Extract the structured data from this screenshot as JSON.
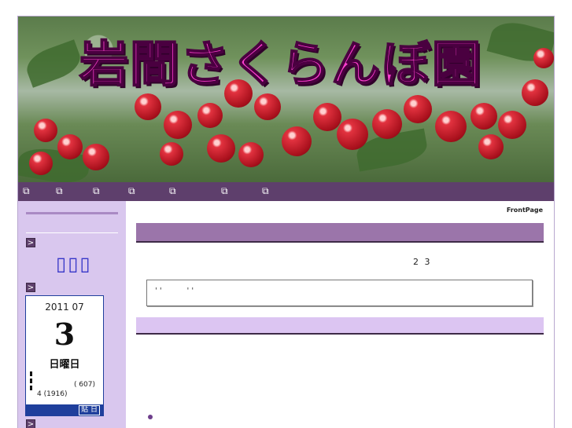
{
  "banner": {
    "title": "岩間さくらんぼ園"
  },
  "nav": {
    "icons": [
      "window-icon",
      "window-icon",
      "window-icon",
      "window-icon",
      "window-icon",
      "window-icon",
      "window-icon"
    ]
  },
  "sidebar": {
    "arrow_label": ">",
    "boxes": "▯▯▯",
    "calendar": {
      "year_month": "2011 07",
      "day": "3",
      "weekday": "日曜日",
      "small1": "( 607)",
      "small2": "4    (1916)",
      "button": "貼 日"
    }
  },
  "main": {
    "frontpage": "FrontPage",
    "numtext": "2 3",
    "quote": "' '          ' '"
  },
  "colors": {
    "accent": "#5e3f6c",
    "sidebar_bg": "#d9c7ee",
    "heading_bar": "#9b75aa",
    "calendar_blue": "#1f3f9c"
  }
}
